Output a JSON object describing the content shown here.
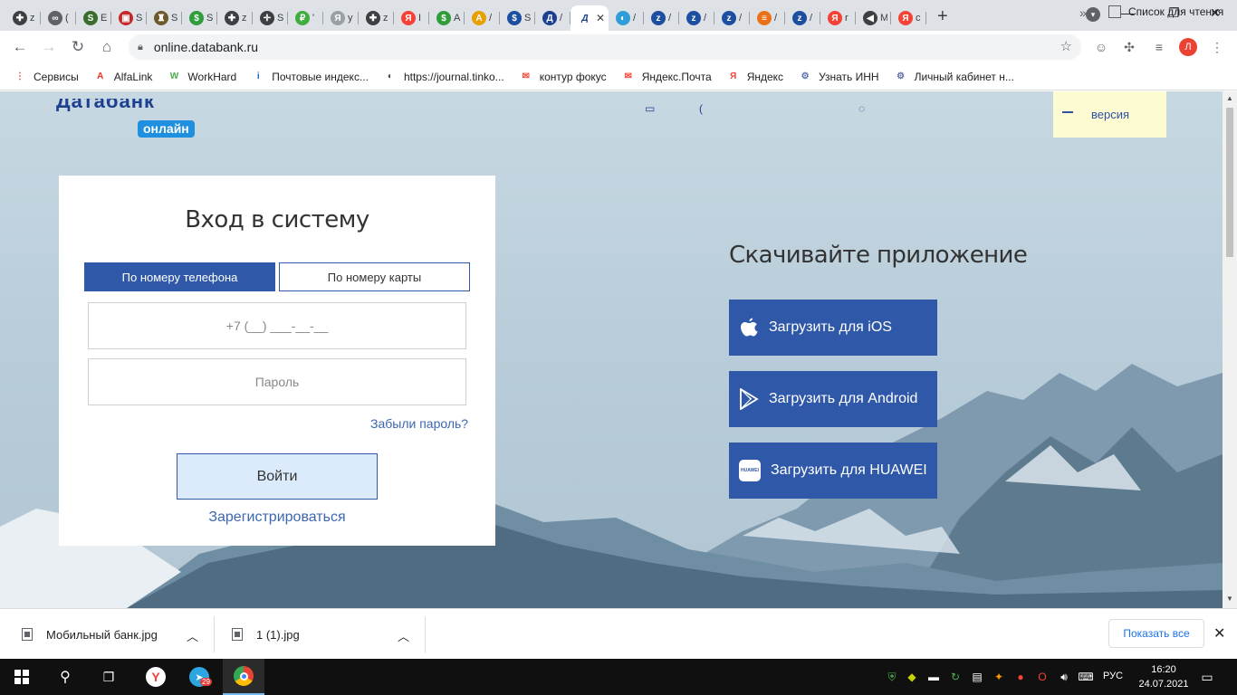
{
  "browser": {
    "tabs": [
      {
        "icon": "plus-circle-icon",
        "label": "z",
        "color": "#3c4043"
      },
      {
        "icon": "infinity-icon",
        "label": "(",
        "color": "#5f6368"
      },
      {
        "icon": "s-square-icon",
        "label": "E",
        "color": "#3a6d2e"
      },
      {
        "icon": "bank-icon",
        "label": "S",
        "color": "#c62828"
      },
      {
        "icon": "game-icon",
        "label": "S",
        "color": "#6d5b2b"
      },
      {
        "icon": "dollar-icon",
        "label": "S",
        "color": "#2e9d3a"
      },
      {
        "icon": "plus-circle-icon",
        "label": "z",
        "color": "#3c4043"
      },
      {
        "icon": "crosshair-icon",
        "label": "S",
        "color": "#3c4043"
      },
      {
        "icon": "wallet-icon",
        "label": "'",
        "color": "#3fae3f"
      },
      {
        "icon": "yandex-gray-icon",
        "label": "y",
        "color": "#9aa0a6"
      },
      {
        "icon": "plus-circle-icon",
        "label": "z",
        "color": "#3c4043"
      },
      {
        "icon": "yandex-icon",
        "label": "I",
        "color": "#f44336"
      },
      {
        "icon": "dollar-icon",
        "label": "A",
        "color": "#2e9d3a"
      },
      {
        "icon": "a-logo-icon",
        "label": "/",
        "color": "#e8a000"
      },
      {
        "icon": "s-dollar-icon",
        "label": "S",
        "color": "#1d4fa0"
      },
      {
        "icon": "databank-icon",
        "label": "/",
        "color": "#1d3f8f"
      }
    ],
    "active_tab": {
      "icon": "databank-icon",
      "label": "Д"
    },
    "tabs_after": [
      {
        "icon": "globe-icon",
        "label": "/",
        "color": "#2e9dd8"
      },
      {
        "icon": "z-circle-icon",
        "label": "/",
        "color": "#1d4fa0"
      },
      {
        "icon": "z-circle-icon",
        "label": "/",
        "color": "#1d4fa0"
      },
      {
        "icon": "z-circle-icon",
        "label": "/",
        "color": "#1d4fa0"
      },
      {
        "icon": "bars-icon",
        "label": "/",
        "color": "#e8711a"
      },
      {
        "icon": "z-circle-icon",
        "label": "/",
        "color": "#1d4fa0"
      },
      {
        "icon": "yandex-icon",
        "label": "r",
        "color": "#f44336"
      },
      {
        "icon": "audio-icon",
        "label": "M",
        "color": "#3c4043"
      },
      {
        "icon": "yandex-icon",
        "label": "c",
        "color": "#f44336"
      }
    ],
    "url": "online.databank.ru",
    "profile_letter": "Л",
    "bookmarks": [
      {
        "icon": "apps-grid-icon",
        "label": "Сервисы",
        "color": "#ea4335"
      },
      {
        "icon": "alfa-icon",
        "label": "AlfaLink",
        "color": "#ef3124"
      },
      {
        "icon": "workhard-icon",
        "label": "WorkHard",
        "color": "#4caf50"
      },
      {
        "icon": "info-icon",
        "label": "Почтовые индекс...",
        "color": "#1565c0"
      },
      {
        "icon": "globe-icon",
        "label": "https://journal.tinko...",
        "color": "#3c4043"
      },
      {
        "icon": "mail-icon",
        "label": "контур фокус",
        "color": "#f44336"
      },
      {
        "icon": "mail-icon",
        "label": "Яндекс.Почта",
        "color": "#f44336"
      },
      {
        "icon": "yandex-icon",
        "label": "Яндекс",
        "color": "#f44336"
      },
      {
        "icon": "emblem-icon",
        "label": "Узнать ИНН",
        "color": "#5b6fa8"
      },
      {
        "icon": "emblem-icon",
        "label": "Личный кабинет н...",
        "color": "#5b6fa8"
      }
    ],
    "more_bookmarks": "»",
    "reading_list": "Список для чтения"
  },
  "page": {
    "logo_top": "Датабанк",
    "logo_badge": "онлайн",
    "version_label": "версия",
    "login": {
      "title": "Вход в систему",
      "tab_phone": "По номеру телефона",
      "tab_card": "По номеру карты",
      "phone_placeholder": "+7 (__) ___-__-__",
      "password_placeholder": "Пароль",
      "forgot": "Забыли пароль?",
      "submit": "Войти",
      "register": "Зарегистрироваться"
    },
    "apps": {
      "title": "Скачивайте приложение",
      "ios": "Загрузить для iOS",
      "android": "Загрузить для Android",
      "huawei": "Загрузить для HUAWEI",
      "huawei_icon_text": "HUAWEI"
    }
  },
  "downloads": {
    "items": [
      {
        "name": "Мобильный банк.jpg"
      },
      {
        "name": "1 (1).jpg"
      }
    ],
    "show_all": "Показать все"
  },
  "taskbar": {
    "telegram_badge": "29",
    "lang": "РУС",
    "time": "16:20",
    "date": "24.07.2021"
  }
}
